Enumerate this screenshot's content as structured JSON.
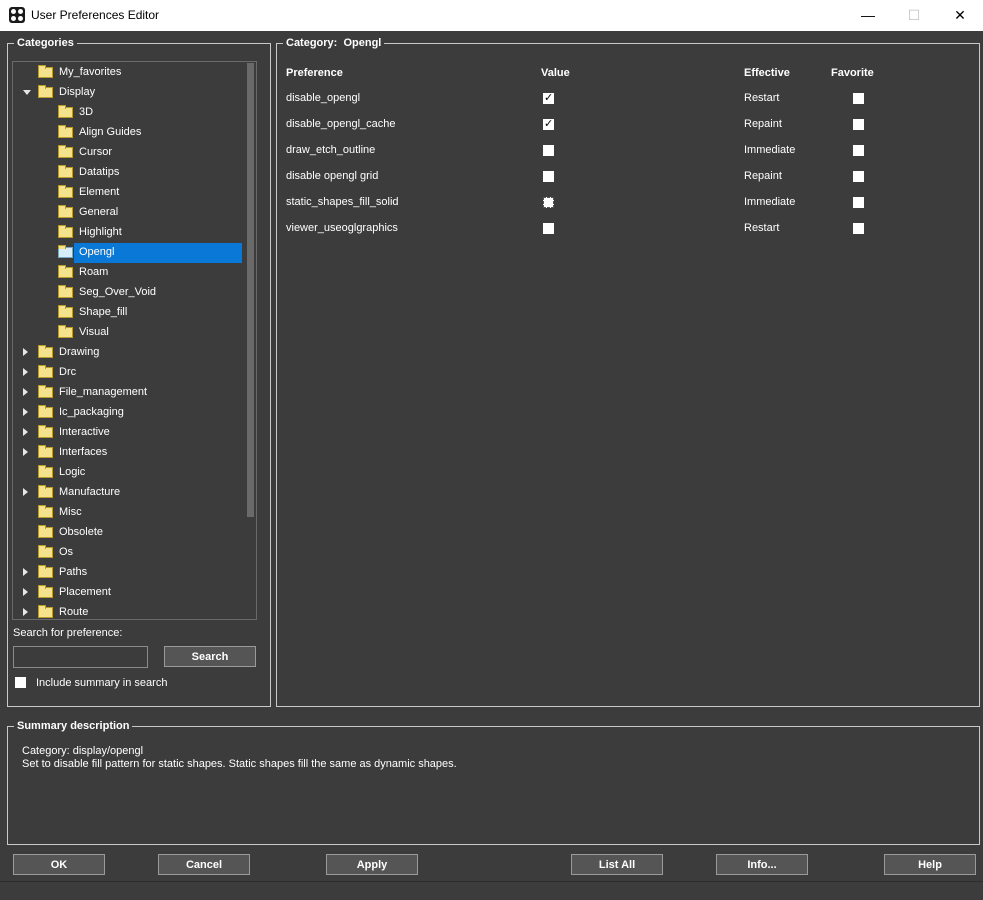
{
  "window": {
    "title": "User Preferences Editor",
    "controls": {
      "minimize": "—",
      "maximize": "☐",
      "close": "✕"
    }
  },
  "categories": {
    "legend": "Categories",
    "tree": [
      {
        "label": "My_favorites",
        "depth": 0,
        "expander": "none"
      },
      {
        "label": "Display",
        "depth": 0,
        "expander": "expanded"
      },
      {
        "label": "3D",
        "depth": 1,
        "expander": "none"
      },
      {
        "label": "Align Guides",
        "depth": 1,
        "expander": "none"
      },
      {
        "label": "Cursor",
        "depth": 1,
        "expander": "none"
      },
      {
        "label": "Datatips",
        "depth": 1,
        "expander": "none"
      },
      {
        "label": "Element",
        "depth": 1,
        "expander": "none"
      },
      {
        "label": "General",
        "depth": 1,
        "expander": "none"
      },
      {
        "label": "Highlight",
        "depth": 1,
        "expander": "none"
      },
      {
        "label": "Opengl",
        "depth": 1,
        "expander": "none",
        "selected": true
      },
      {
        "label": "Roam",
        "depth": 1,
        "expander": "none"
      },
      {
        "label": "Seg_Over_Void",
        "depth": 1,
        "expander": "none"
      },
      {
        "label": "Shape_fill",
        "depth": 1,
        "expander": "none"
      },
      {
        "label": "Visual",
        "depth": 1,
        "expander": "none"
      },
      {
        "label": "Drawing",
        "depth": 0,
        "expander": "collapsed"
      },
      {
        "label": "Drc",
        "depth": 0,
        "expander": "collapsed"
      },
      {
        "label": "File_management",
        "depth": 0,
        "expander": "collapsed"
      },
      {
        "label": "Ic_packaging",
        "depth": 0,
        "expander": "collapsed"
      },
      {
        "label": "Interactive",
        "depth": 0,
        "expander": "collapsed"
      },
      {
        "label": "Interfaces",
        "depth": 0,
        "expander": "collapsed"
      },
      {
        "label": "Logic",
        "depth": 0,
        "expander": "none"
      },
      {
        "label": "Manufacture",
        "depth": 0,
        "expander": "collapsed"
      },
      {
        "label": "Misc",
        "depth": 0,
        "expander": "none"
      },
      {
        "label": "Obsolete",
        "depth": 0,
        "expander": "none"
      },
      {
        "label": "Os",
        "depth": 0,
        "expander": "none"
      },
      {
        "label": "Paths",
        "depth": 0,
        "expander": "collapsed"
      },
      {
        "label": "Placement",
        "depth": 0,
        "expander": "collapsed"
      },
      {
        "label": "Route",
        "depth": 0,
        "expander": "collapsed"
      }
    ],
    "search_label": "Search for preference:",
    "search_value": "",
    "search_button": "Search",
    "include_summary_label": "Include summary in search",
    "include_summary_checked": false
  },
  "category_panel": {
    "legend_prefix": "Category:",
    "legend_name": "Opengl",
    "headers": {
      "preference": "Preference",
      "value": "Value",
      "effective": "Effective",
      "favorite": "Favorite"
    },
    "rows": [
      {
        "preference": "disable_opengl",
        "value": true,
        "effective": "Restart",
        "favorite": false
      },
      {
        "preference": "disable_opengl_cache",
        "value": true,
        "effective": "Repaint",
        "favorite": false
      },
      {
        "preference": "draw_etch_outline",
        "value": false,
        "effective": "Immediate",
        "favorite": false
      },
      {
        "preference": "disable opengl grid",
        "value": false,
        "effective": "Repaint",
        "favorite": false
      },
      {
        "preference": "static_shapes_fill_solid",
        "value": false,
        "effective": "Immediate",
        "favorite": false,
        "focused": true
      },
      {
        "preference": "viewer_useoglgraphics",
        "value": false,
        "effective": "Restart",
        "favorite": false
      }
    ]
  },
  "summary": {
    "legend": "Summary description",
    "category_line": "Category: display/opengl",
    "description": "Set to disable fill pattern for static shapes. Static shapes fill the same as dynamic shapes."
  },
  "buttons": {
    "ok": "OK",
    "cancel": "Cancel",
    "apply": "Apply",
    "list_all": "List All",
    "info": "Info...",
    "help": "Help"
  },
  "colors": {
    "background": "#3c3c3c",
    "selection": "#0a78d7",
    "folder": "#f4e28c",
    "border": "#c8c8c8"
  },
  "icons": {
    "folder": "folder-icon",
    "app": "app-icon",
    "check": "✓"
  }
}
